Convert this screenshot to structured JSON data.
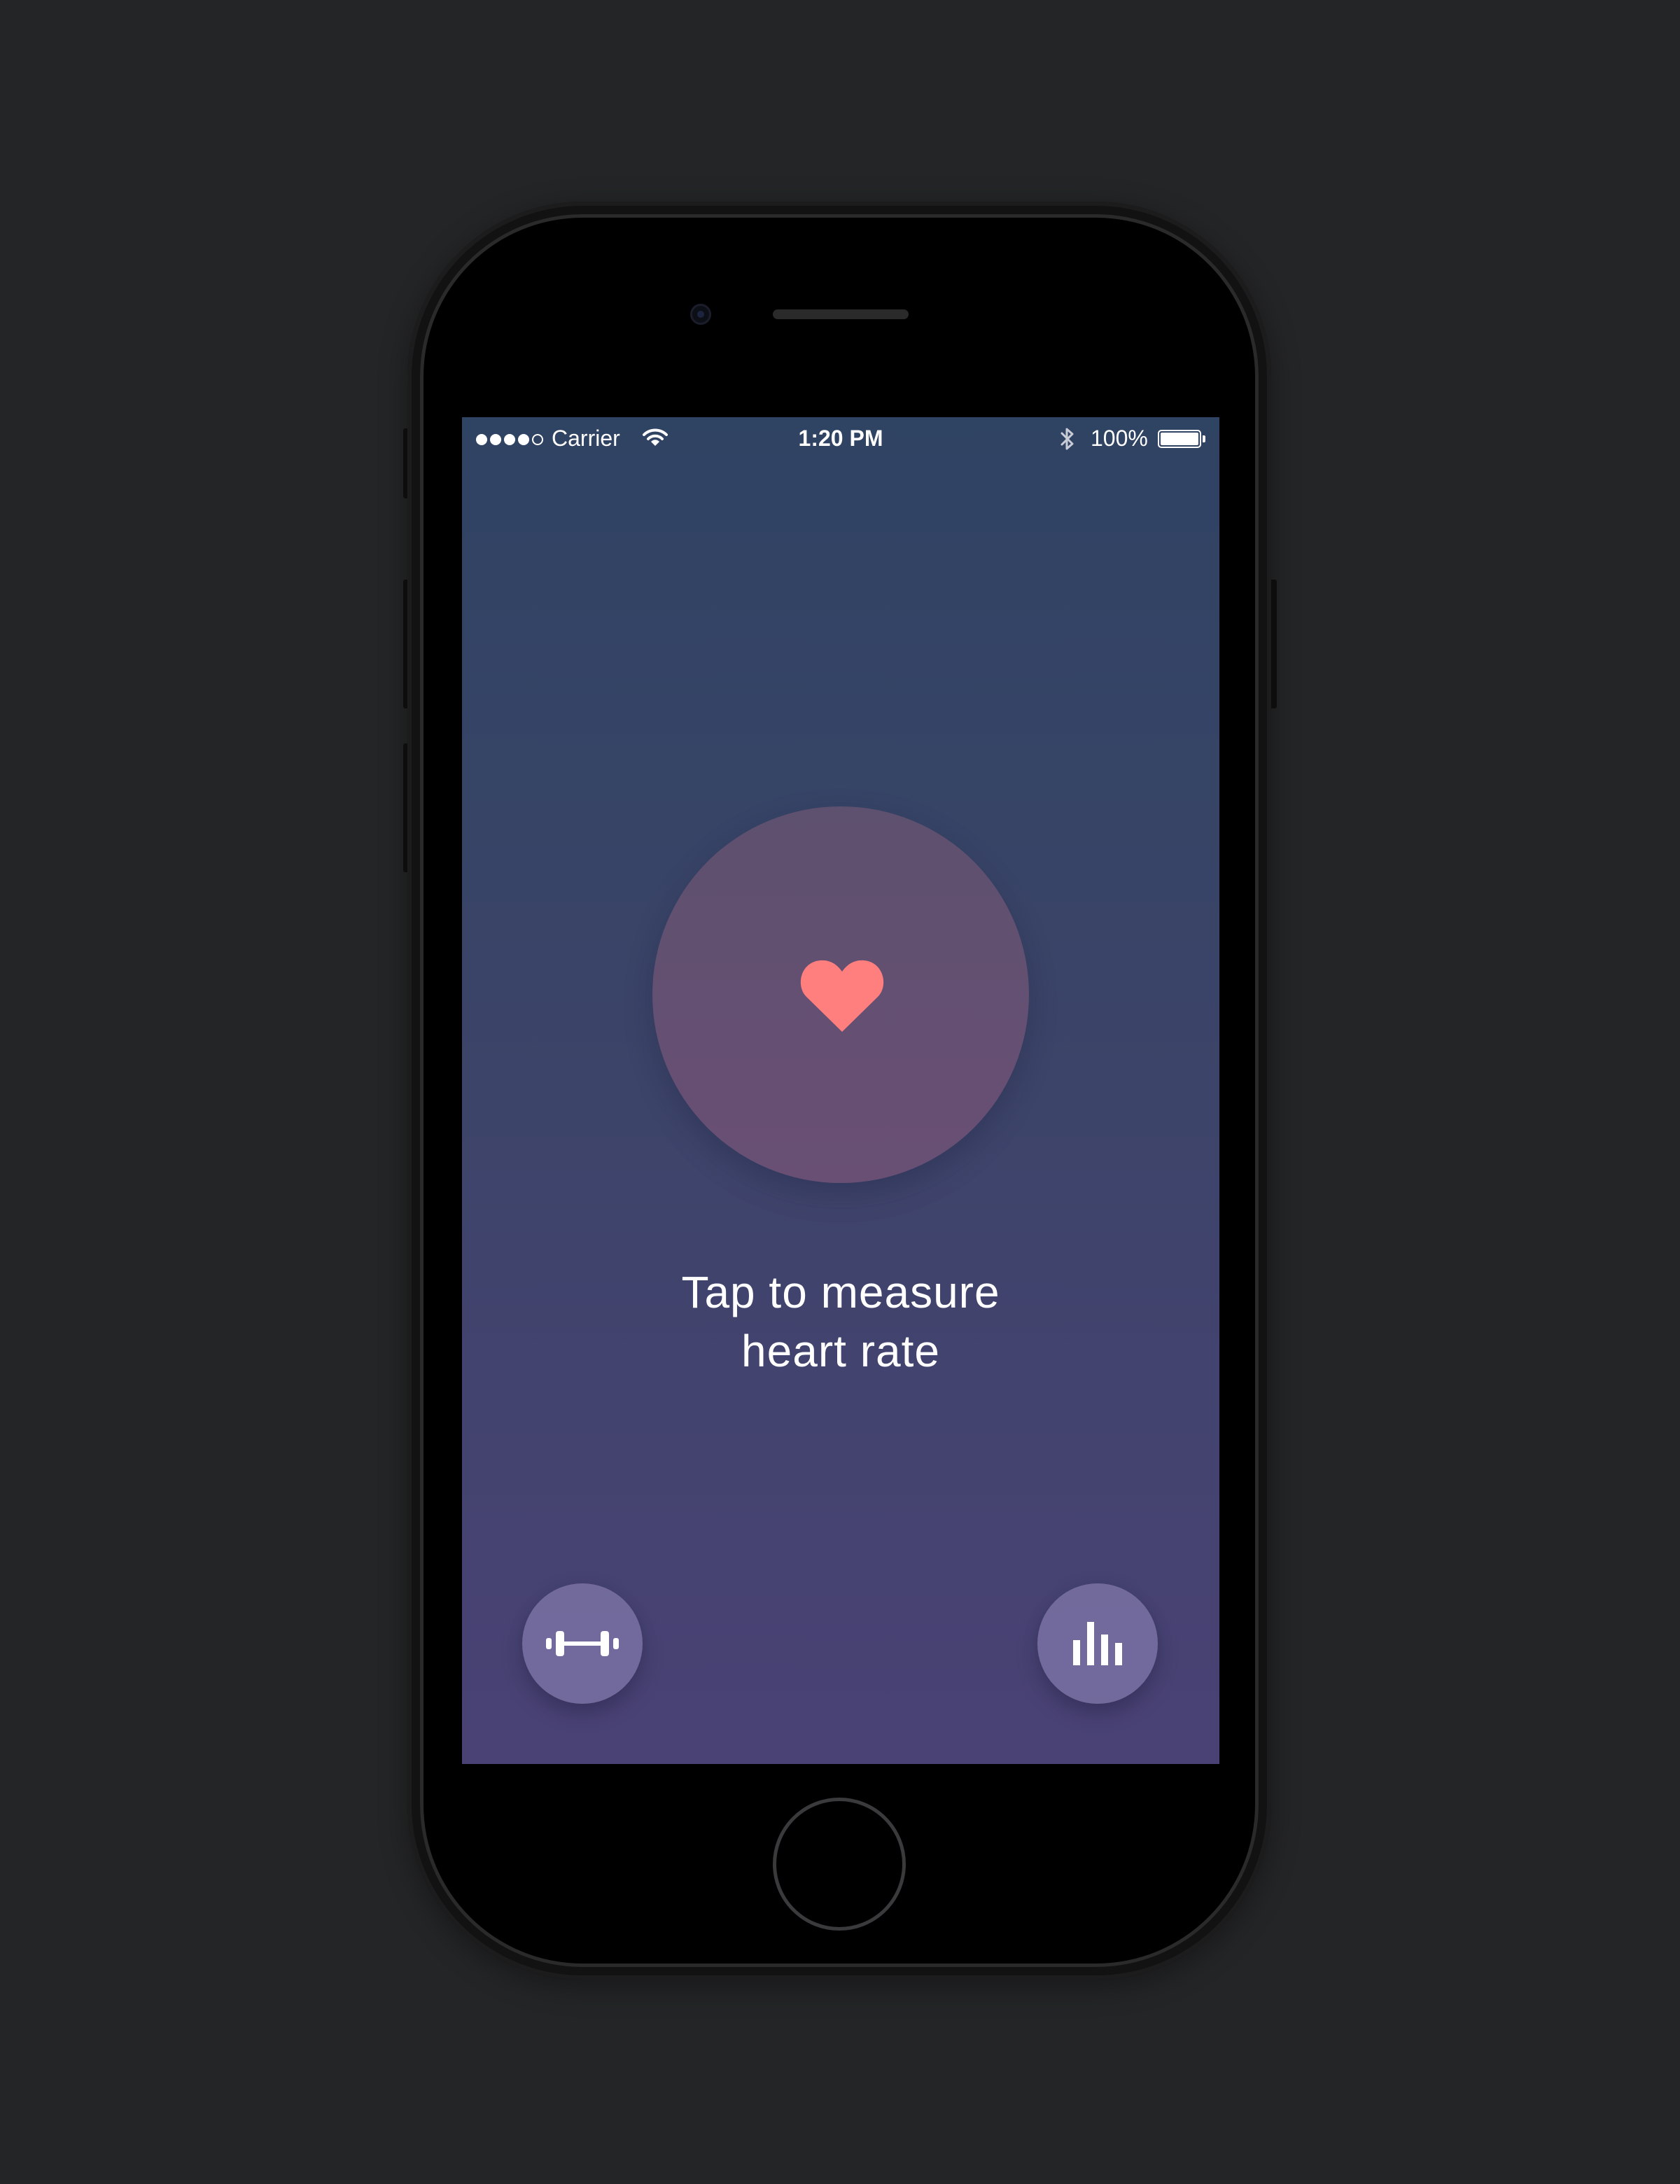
{
  "status_bar": {
    "carrier": "Carrier",
    "time": "1:20 PM",
    "battery": "100%",
    "signal_bars_filled": 4,
    "signal_bars_total": 5
  },
  "main": {
    "prompt_line1": "Tap to measure",
    "prompt_line2": "heart rate",
    "heart_icon": "heart-icon"
  },
  "bottom": {
    "left_icon": "dumbbell-icon",
    "right_icon": "bar-chart-icon"
  },
  "colors": {
    "background": "#242526",
    "screen_top": "#2f4363",
    "screen_bottom": "#4a4275",
    "heart": "#ff7f7f",
    "circle": "#63506f"
  }
}
